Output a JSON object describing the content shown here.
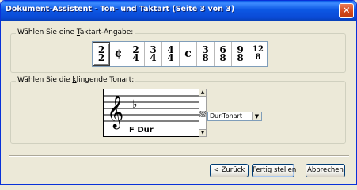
{
  "window": {
    "title": "Dokument-Assistent - Ton- und Taktart (Seite 3 von 3)",
    "close_glyph": "✕"
  },
  "time_signature": {
    "legend_prefix": "Wählen Sie eine ",
    "legend_accel": "T",
    "legend_suffix": "aktart-Angabe:",
    "options": [
      {
        "num": "2",
        "den": "2"
      },
      {
        "glyph": "¢"
      },
      {
        "num": "2",
        "den": "4"
      },
      {
        "num": "3",
        "den": "4"
      },
      {
        "num": "4",
        "den": "4"
      },
      {
        "glyph": "c"
      },
      {
        "num": "3",
        "den": "8"
      },
      {
        "num": "6",
        "den": "8"
      },
      {
        "num": "9",
        "den": "8"
      },
      {
        "num": "12",
        "den": "8"
      }
    ],
    "selected_index": 0
  },
  "key_signature": {
    "legend_prefix": "Wählen Sie die ",
    "legend_accel": "k",
    "legend_suffix": "lingende Tonart:",
    "key_name": "F Dur",
    "mode_select": {
      "value": "Dur-Tonart"
    }
  },
  "buttons": {
    "back_prefix": "< ",
    "back_accel": "Z",
    "back_suffix": "urück",
    "finish": "Fertig stellen",
    "cancel": "Abbrechen"
  },
  "colors": {
    "titlebar": "#0a4ad6",
    "close": "#d1481c",
    "dialog_bg": "#ece9d8"
  }
}
